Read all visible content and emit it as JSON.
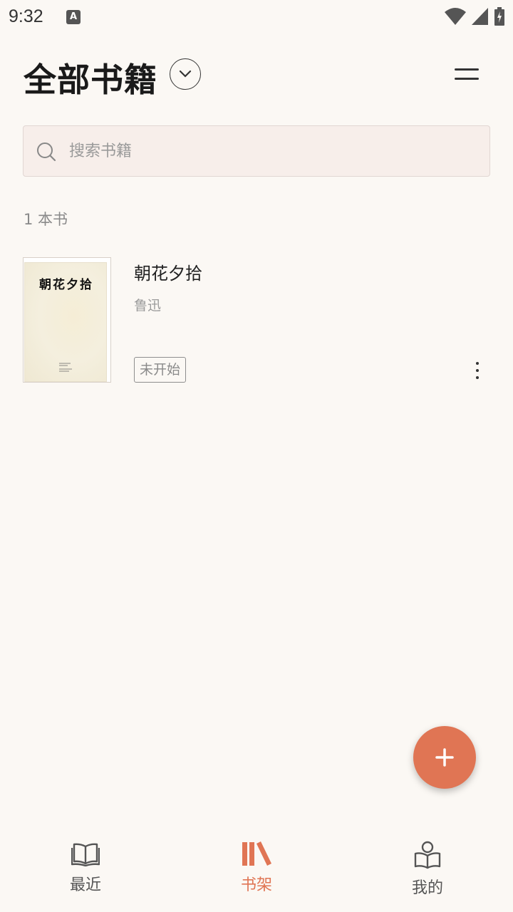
{
  "status_bar": {
    "time": "9:32",
    "notification_icon": "A"
  },
  "header": {
    "title": "全部书籍"
  },
  "search": {
    "placeholder": "搜索书籍"
  },
  "library": {
    "count_label": "1 本书",
    "books": [
      {
        "title": "朝花夕拾",
        "author": "鲁迅",
        "status": "未开始",
        "cover_title": "朝花夕拾"
      }
    ]
  },
  "bottom_nav": {
    "items": [
      {
        "label": "最近",
        "icon": "open-book-icon",
        "active": false
      },
      {
        "label": "书架",
        "icon": "bookshelf-icon",
        "active": true
      },
      {
        "label": "我的",
        "icon": "profile-reader-icon",
        "active": false
      }
    ]
  },
  "colors": {
    "accent": "#e07554",
    "background": "#fbf8f4",
    "search_bg": "#f7eeea"
  }
}
